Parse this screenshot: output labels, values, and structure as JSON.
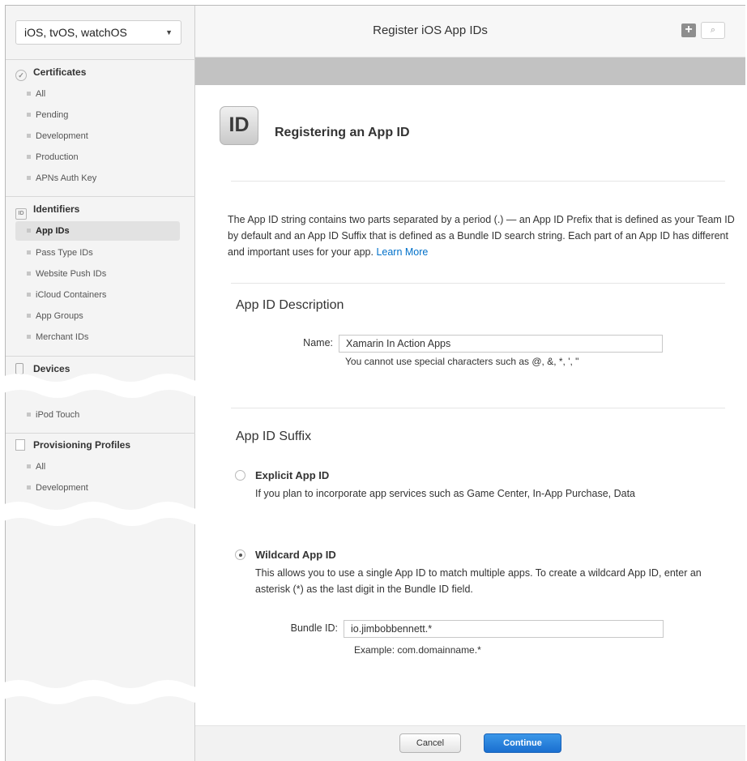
{
  "sidebar": {
    "platform_select": "iOS, tvOS, watchOS",
    "certificates": {
      "title": "Certificates",
      "items": [
        "All",
        "Pending",
        "Development",
        "Production",
        "APNs Auth Key"
      ]
    },
    "identifiers": {
      "title": "Identifiers",
      "items": [
        "App IDs",
        "Pass Type IDs",
        "Website Push IDs",
        "iCloud Containers",
        "App Groups",
        "Merchant IDs"
      ],
      "active": "App IDs"
    },
    "devices": {
      "title": "Devices",
      "items": [
        "iPod Touch"
      ]
    },
    "provisioning": {
      "title": "Provisioning Profiles",
      "items": [
        "All",
        "Development"
      ]
    }
  },
  "header": {
    "title": "Register iOS App IDs",
    "add_icon": "plus-icon",
    "search_icon": "search-icon"
  },
  "main": {
    "heading": "Registering an App ID",
    "id_icon_text": "ID",
    "intro": "The App ID string contains two parts separated by a period (.) — an App ID Prefix that is defined as your Team ID by default and an App ID Suffix that is defined as a Bundle ID search string. Each part of an App ID has different and important uses for your app.",
    "learn_more": "Learn More",
    "description_section": {
      "title": "App ID Description",
      "name_label": "Name:",
      "name_value": "Xamarin In Action Apps",
      "hint": "You cannot use special characters such as @, &, *, ', \""
    },
    "suffix_section": {
      "title": "App ID Suffix",
      "explicit": {
        "title": "Explicit App ID",
        "desc": "If you plan to incorporate app services such as Game Center, In-App Purchase, Data",
        "selected": false
      },
      "wildcard": {
        "title": "Wildcard App ID",
        "desc": "This allows you to use a single App ID to match multiple apps. To create a wildcard App ID, enter an asterisk (*) as the last digit in the Bundle ID field.",
        "selected": true,
        "bundle_label": "Bundle ID:",
        "bundle_value": "io.jimbobbennett.*",
        "example": "Example: com.domainname.*"
      }
    }
  },
  "footer": {
    "cancel": "Cancel",
    "continue": "Continue"
  },
  "colors": {
    "link": "#0070c9",
    "primary_button": "#1a6fd0",
    "sidebar_bg": "#f4f4f4",
    "header_band": "#c2c2c2"
  }
}
